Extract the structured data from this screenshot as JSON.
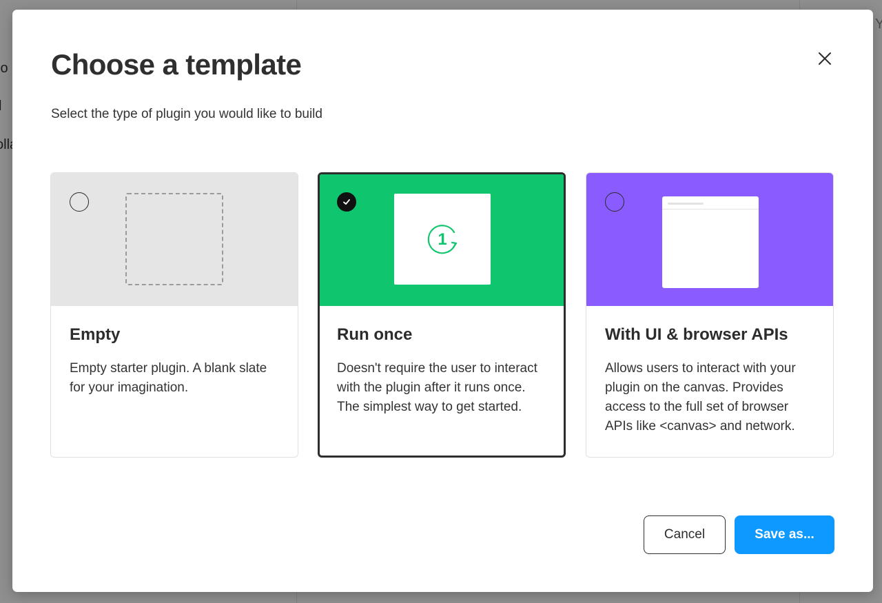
{
  "background": {
    "snippets": [
      "lo",
      "l",
      "olla",
      "Y"
    ]
  },
  "dialog": {
    "title": "Choose a template",
    "subtitle": "Select the type of plugin you would like to build",
    "close_icon": "close-icon"
  },
  "templates": [
    {
      "title": "Empty",
      "description": "Empty starter plugin. A blank slate for your imagination.",
      "selected": false,
      "preview_color": "#e5e5e5"
    },
    {
      "title": "Run once",
      "description": "Doesn't require the user to interact with the plugin after it runs once. The simplest way to get started.",
      "selected": true,
      "preview_color": "#0fc66f",
      "preview_icon": "run-once-icon",
      "preview_icon_text": "1"
    },
    {
      "title": "With UI & browser APIs",
      "description": "Allows users to interact with your plugin on the canvas. Provides access to the full set of browser APIs like <canvas> and network.",
      "selected": false,
      "preview_color": "#8a5cff"
    }
  ],
  "footer": {
    "cancel_label": "Cancel",
    "save_label": "Save as..."
  },
  "colors": {
    "accent": "#0d99ff",
    "selected_border": "#2d2d2d"
  }
}
